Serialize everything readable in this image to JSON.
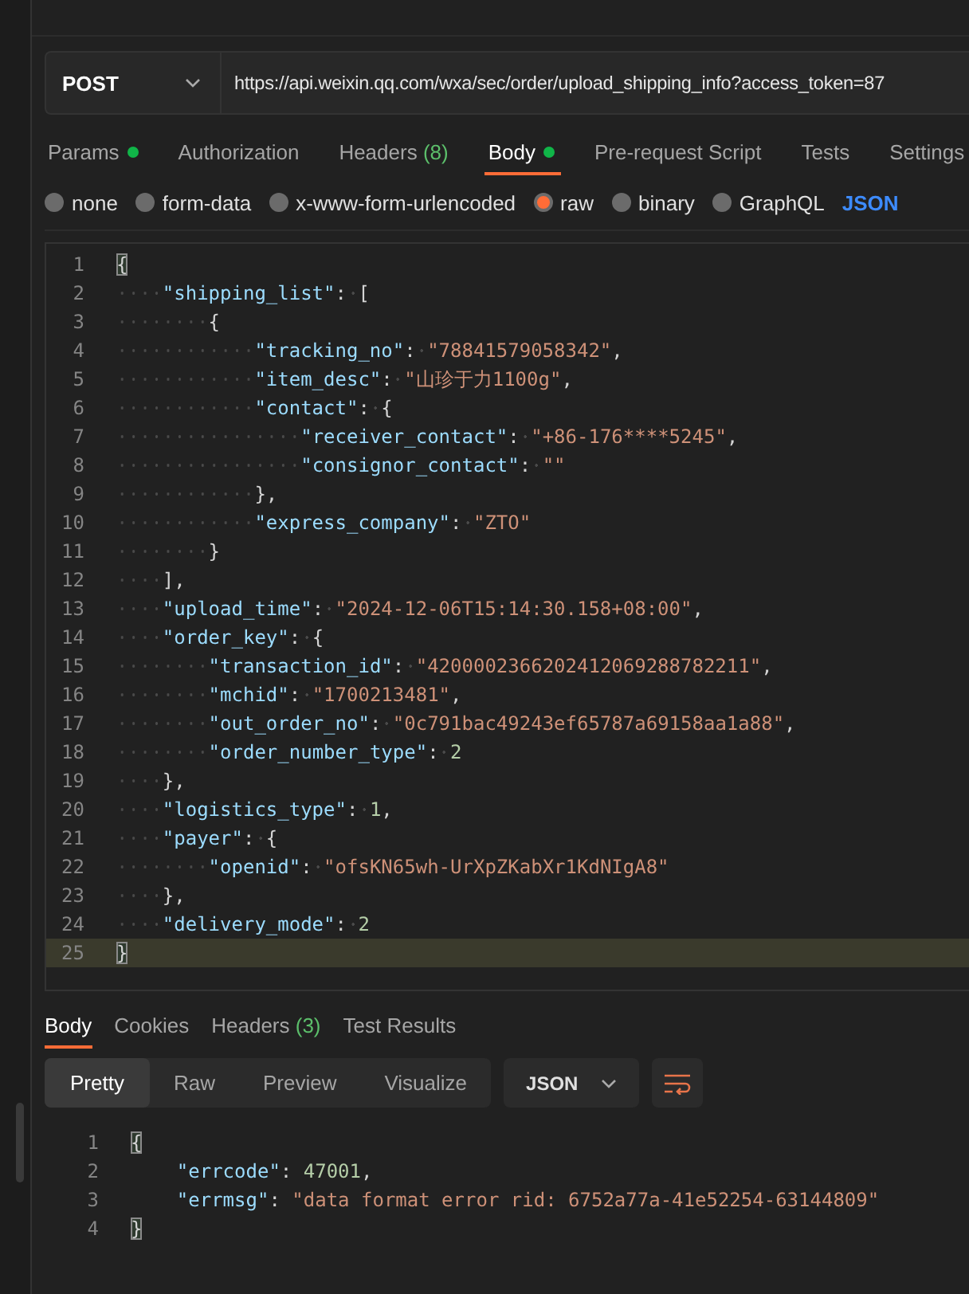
{
  "request": {
    "method": "POST",
    "url": "https://api.weixin.qq.com/wxa/sec/order/upload_shipping_info?access_token=87",
    "tabs": [
      {
        "label": "Params",
        "dot": true,
        "selected": false
      },
      {
        "label": "Authorization",
        "dot": false,
        "selected": false
      },
      {
        "label": "Headers",
        "count": "(8)",
        "dot": false,
        "selected": false
      },
      {
        "label": "Body",
        "dot": true,
        "selected": true
      },
      {
        "label": "Pre-request Script",
        "dot": false,
        "selected": false
      },
      {
        "label": "Tests",
        "dot": false,
        "selected": false
      },
      {
        "label": "Settings",
        "dot": false,
        "selected": false
      }
    ],
    "body_types": [
      {
        "label": "none",
        "selected": false
      },
      {
        "label": "form-data",
        "selected": false
      },
      {
        "label": "x-www-form-urlencoded",
        "selected": false
      },
      {
        "label": "raw",
        "selected": true
      },
      {
        "label": "binary",
        "selected": false
      },
      {
        "label": "GraphQL",
        "selected": false
      }
    ],
    "format": "JSON",
    "lines": [
      {
        "no": "1",
        "text": "{",
        "current": false,
        "bracket": true
      },
      {
        "no": "2",
        "text": "    \"shipping_list\": [",
        "current": false,
        "bracket": false
      },
      {
        "no": "3",
        "text": "        {",
        "current": false,
        "bracket": false
      },
      {
        "no": "4",
        "text": "            \"tracking_no\": \"78841579058342\",",
        "current": false,
        "bracket": false
      },
      {
        "no": "5",
        "text": "            \"item_desc\": \"山珍于力1100g\",",
        "current": false,
        "bracket": false
      },
      {
        "no": "6",
        "text": "            \"contact\": {",
        "current": false,
        "bracket": false
      },
      {
        "no": "7",
        "text": "                \"receiver_contact\": \"+86-176****5245\",",
        "current": false,
        "bracket": false
      },
      {
        "no": "8",
        "text": "                \"consignor_contact\": \"\"",
        "current": false,
        "bracket": false
      },
      {
        "no": "9",
        "text": "            },",
        "current": false,
        "bracket": false
      },
      {
        "no": "10",
        "text": "            \"express_company\": \"ZTO\"",
        "current": false,
        "bracket": false
      },
      {
        "no": "11",
        "text": "        }",
        "current": false,
        "bracket": false
      },
      {
        "no": "12",
        "text": "    ],",
        "current": false,
        "bracket": false
      },
      {
        "no": "13",
        "text": "    \"upload_time\": \"2024-12-06T15:14:30.158+08:00\",",
        "current": false,
        "bracket": false
      },
      {
        "no": "14",
        "text": "    \"order_key\": {",
        "current": false,
        "bracket": false
      },
      {
        "no": "15",
        "text": "        \"transaction_id\": \"4200002366202412069288782211\",",
        "current": false,
        "bracket": false
      },
      {
        "no": "16",
        "text": "        \"mchid\": \"1700213481\",",
        "current": false,
        "bracket": false
      },
      {
        "no": "17",
        "text": "        \"out_order_no\": \"0c791bac49243ef65787a69158aa1a88\",",
        "current": false,
        "bracket": false
      },
      {
        "no": "18",
        "text": "        \"order_number_type\": 2",
        "current": false,
        "bracket": false
      },
      {
        "no": "19",
        "text": "    },",
        "current": false,
        "bracket": false
      },
      {
        "no": "20",
        "text": "    \"logistics_type\": 1,",
        "current": false,
        "bracket": false
      },
      {
        "no": "21",
        "text": "    \"payer\": {",
        "current": false,
        "bracket": false
      },
      {
        "no": "22",
        "text": "        \"openid\": \"ofsKN65wh-UrXpZKabXr1KdNIgA8\"",
        "current": false,
        "bracket": false
      },
      {
        "no": "23",
        "text": "    },",
        "current": false,
        "bracket": false
      },
      {
        "no": "24",
        "text": "    \"delivery_mode\": 2",
        "current": false,
        "bracket": false
      },
      {
        "no": "25",
        "text": "}",
        "current": true,
        "bracket": true
      }
    ]
  },
  "response": {
    "tabs": [
      {
        "label": "Body",
        "selected": true
      },
      {
        "label": "Cookies",
        "selected": false
      },
      {
        "label": "Headers",
        "count": "(3)",
        "selected": false
      },
      {
        "label": "Test Results",
        "selected": false
      }
    ],
    "views": [
      {
        "label": "Pretty",
        "selected": true
      },
      {
        "label": "Raw",
        "selected": false
      },
      {
        "label": "Preview",
        "selected": false
      },
      {
        "label": "Visualize",
        "selected": false
      }
    ],
    "format": "JSON",
    "lines": [
      {
        "no": "1",
        "text": "{",
        "bracket": true
      },
      {
        "no": "2",
        "text": "    \"errcode\": 47001,",
        "bracket": false
      },
      {
        "no": "3",
        "text": "    \"errmsg\": \"data format error rid: 6752a77a-41e52254-63144809\"",
        "bracket": false
      },
      {
        "no": "4",
        "text": "}",
        "bracket": true
      }
    ]
  }
}
